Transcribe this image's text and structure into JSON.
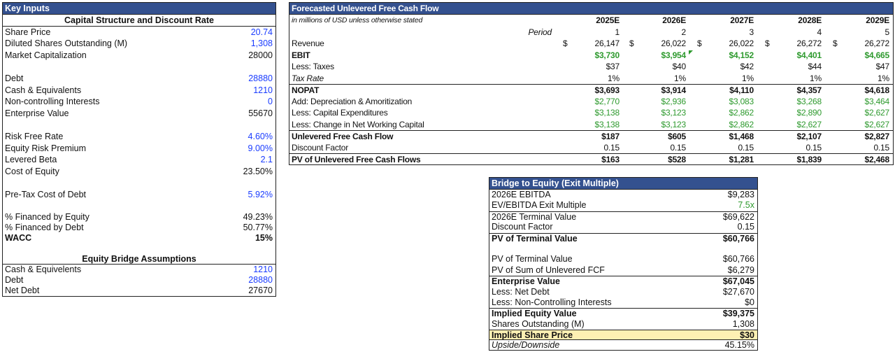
{
  "key_inputs": {
    "title": "Key Inputs",
    "rows": [
      {
        "label": "Capital Structure and Discount Rate",
        "value": ""
      },
      {
        "label": "Share Price",
        "value": "20.74"
      },
      {
        "label": "Diluted Shares Outstanding (M)",
        "value": "1,308"
      },
      {
        "label": "Market Capitalization",
        "value": "28000"
      },
      {
        "label": "",
        "value": ""
      },
      {
        "label": "Debt",
        "value": "28880"
      },
      {
        "label": "Cash & Equivalents",
        "value": "1210"
      },
      {
        "label": "Non-controlling Interests",
        "value": "0"
      },
      {
        "label": "Enterprise Value",
        "value": "55670"
      },
      {
        "label": "",
        "value": ""
      },
      {
        "label": "Risk Free Rate",
        "value": "4.60%"
      },
      {
        "label": "Equity Risk Premium",
        "value": "9.00%"
      },
      {
        "label": "Levered Beta",
        "value": "2.1"
      },
      {
        "label": "Cost of Equity",
        "value": "23.50%"
      },
      {
        "label": "",
        "value": ""
      },
      {
        "label": "Pre-Tax Cost of Debt",
        "value": "5.92%"
      },
      {
        "label": "",
        "value": ""
      },
      {
        "label": "% Financed by Equity",
        "value": "49.23%"
      },
      {
        "label": "% Financed by Debt",
        "value": "50.77%"
      },
      {
        "label": "WACC",
        "value": "15%"
      },
      {
        "label": "",
        "value": ""
      },
      {
        "label": "Equity Bridge Assumptions",
        "value": ""
      },
      {
        "label": "Cash & Equivelents",
        "value": "1210"
      },
      {
        "label": "Debt",
        "value": "28880"
      },
      {
        "label": "Net Debt",
        "value": "27670"
      }
    ]
  },
  "fcf": {
    "title": "Forecasted Unlevered Free Cash Flow",
    "rows": [
      {
        "label": "in millions of USD unless otherwise stated",
        "pre": "",
        "values": [
          "2025E",
          "2026E",
          "2027E",
          "2028E",
          "2029E"
        ]
      },
      {
        "label": "",
        "pre": "Period",
        "values": [
          "1",
          "2",
          "3",
          "4",
          "5"
        ]
      },
      {
        "label": "Revenue",
        "pre": "",
        "currency": "$",
        "values": [
          "26,147",
          "26,022",
          "26,022",
          "26,272",
          "26,272"
        ]
      },
      {
        "label": "EBIT",
        "pre": "",
        "values": [
          "$3,730",
          "$3,954",
          "$4,152",
          "$4,401",
          "$4,665"
        ]
      },
      {
        "label": "Less: Taxes",
        "pre": "",
        "values": [
          "$37",
          "$40",
          "$42",
          "$44",
          "$47"
        ]
      },
      {
        "label": "Tax Rate",
        "pre": "",
        "values": [
          "1%",
          "1%",
          "1%",
          "1%",
          "1%"
        ]
      },
      {
        "label": "NOPAT",
        "pre": "",
        "values": [
          "$3,693",
          "$3,914",
          "$4,110",
          "$4,357",
          "$4,618"
        ]
      },
      {
        "label": "Add: Depreciation & Amoritization",
        "pre": "",
        "values": [
          "$2,770",
          "$2,936",
          "$3,083",
          "$3,268",
          "$3,464"
        ]
      },
      {
        "label": "Less: Capital Expenditures",
        "pre": "",
        "values": [
          "$3,138",
          "$3,123",
          "$2,862",
          "$2,890",
          "$2,627"
        ]
      },
      {
        "label": "Less: Change in Net Working Capital",
        "pre": "",
        "values": [
          "$3,138",
          "$3,123",
          "$2,862",
          "$2,627",
          "$2,627"
        ]
      },
      {
        "label": "Unlevered Free Cash Flow",
        "pre": "",
        "values": [
          "$187",
          "$605",
          "$1,468",
          "$2,107",
          "$2,827"
        ]
      },
      {
        "label": "Discount Factor",
        "pre": "",
        "values": [
          "0.15",
          "0.15",
          "0.15",
          "0.15",
          "0.15"
        ]
      },
      {
        "label": "PV of Unlevered Free Cash Flows",
        "pre": "",
        "values": [
          "$163",
          "$528",
          "$1,281",
          "$1,839",
          "$2,468"
        ]
      }
    ]
  },
  "bridge": {
    "title": "Bridge to Equity (Exit Multiple)",
    "rows": [
      {
        "label": "2026E EBITDA",
        "value": "$9,283"
      },
      {
        "label": "EV/EBITDA Exit Multiple",
        "value": "7.5x"
      },
      {
        "label": "2026E Terminal Value",
        "value": "$69,622"
      },
      {
        "label": "Discount Factor",
        "value": "0.15"
      },
      {
        "label": "PV of Terminal Value",
        "value": "$60,766"
      },
      {
        "label": "",
        "value": ""
      },
      {
        "label": "PV of Terminal Value",
        "value": "$60,766"
      },
      {
        "label": "PV of Sum of Unlevered FCF",
        "value": "$6,279"
      },
      {
        "label": "Enterprise Value",
        "value": "$67,045"
      },
      {
        "label": "Less: Net Debt",
        "value": "$27,670"
      },
      {
        "label": "Less: Non-Controlling Interests",
        "value": "$0"
      },
      {
        "label": "Implied Equity Value",
        "value": "$39,375"
      },
      {
        "label": "Shares Outstanding (M)",
        "value": "1,308"
      },
      {
        "label": "Implied Share Price",
        "value": "$30"
      },
      {
        "label": "Upside/Downside",
        "value": "45.15%"
      }
    ]
  },
  "colors": {
    "header": "#34518f",
    "input_blue": "#1a3cff",
    "link_green": "#2e9a2e",
    "highlight": "#fdf0b3"
  }
}
